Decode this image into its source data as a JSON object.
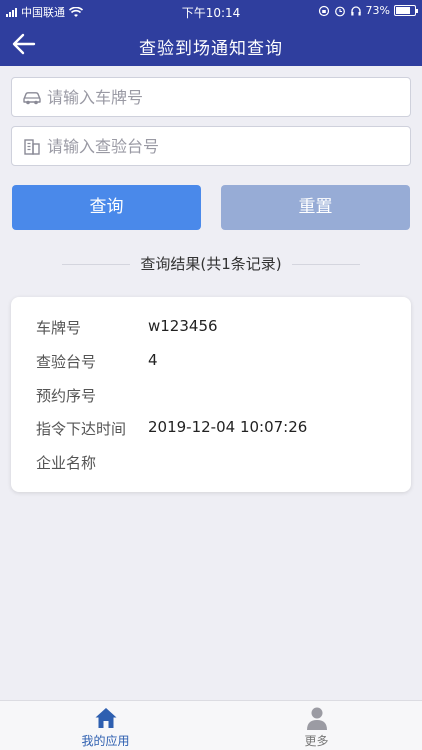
{
  "status_bar": {
    "carrier": "中国联通",
    "time": "下午10:14",
    "battery": "73%"
  },
  "nav": {
    "title": "查验到场通知查询"
  },
  "form": {
    "plate_placeholder": "请输入车牌号",
    "station_placeholder": "请输入查验台号",
    "query_label": "查询",
    "reset_label": "重置"
  },
  "results": {
    "title": "查询结果(共1条记录)",
    "record": {
      "plate_label": "车牌号",
      "plate_value": "w123456",
      "station_label": "查验台号",
      "station_value": "4",
      "seq_label": "预约序号",
      "seq_value": "",
      "time_label": "指令下达时间",
      "time_value": "2019-12-04 10:07:26",
      "company_label": "企业名称",
      "company_value": ""
    }
  },
  "tabbar": {
    "apps_label": "我的应用",
    "more_label": "更多"
  },
  "colors": {
    "header": "#2f3e9e",
    "primary_button": "#4a89ea",
    "reset_button": "#97acd6",
    "active_tab": "#2e5fb0"
  }
}
